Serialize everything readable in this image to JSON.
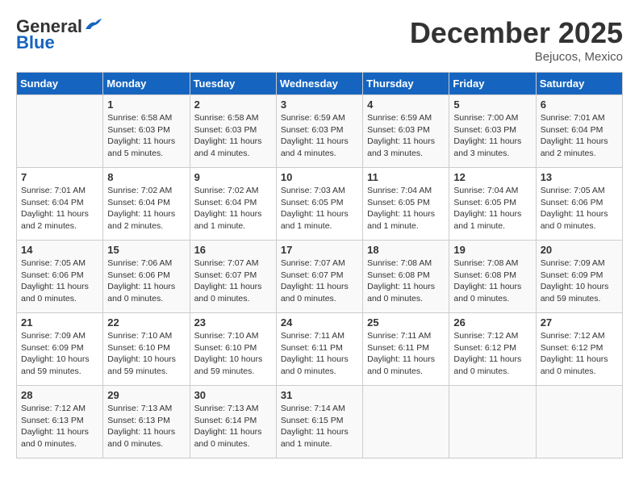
{
  "header": {
    "logo_general": "General",
    "logo_blue": "Blue",
    "month": "December 2025",
    "location": "Bejucos, Mexico"
  },
  "days_of_week": [
    "Sunday",
    "Monday",
    "Tuesday",
    "Wednesday",
    "Thursday",
    "Friday",
    "Saturday"
  ],
  "weeks": [
    [
      {
        "day": "",
        "info": ""
      },
      {
        "day": "1",
        "info": "Sunrise: 6:58 AM\nSunset: 6:03 PM\nDaylight: 11 hours\nand 5 minutes."
      },
      {
        "day": "2",
        "info": "Sunrise: 6:58 AM\nSunset: 6:03 PM\nDaylight: 11 hours\nand 4 minutes."
      },
      {
        "day": "3",
        "info": "Sunrise: 6:59 AM\nSunset: 6:03 PM\nDaylight: 11 hours\nand 4 minutes."
      },
      {
        "day": "4",
        "info": "Sunrise: 6:59 AM\nSunset: 6:03 PM\nDaylight: 11 hours\nand 3 minutes."
      },
      {
        "day": "5",
        "info": "Sunrise: 7:00 AM\nSunset: 6:03 PM\nDaylight: 11 hours\nand 3 minutes."
      },
      {
        "day": "6",
        "info": "Sunrise: 7:01 AM\nSunset: 6:04 PM\nDaylight: 11 hours\nand 2 minutes."
      }
    ],
    [
      {
        "day": "7",
        "info": "Sunrise: 7:01 AM\nSunset: 6:04 PM\nDaylight: 11 hours\nand 2 minutes."
      },
      {
        "day": "8",
        "info": "Sunrise: 7:02 AM\nSunset: 6:04 PM\nDaylight: 11 hours\nand 2 minutes."
      },
      {
        "day": "9",
        "info": "Sunrise: 7:02 AM\nSunset: 6:04 PM\nDaylight: 11 hours\nand 1 minute."
      },
      {
        "day": "10",
        "info": "Sunrise: 7:03 AM\nSunset: 6:05 PM\nDaylight: 11 hours\nand 1 minute."
      },
      {
        "day": "11",
        "info": "Sunrise: 7:04 AM\nSunset: 6:05 PM\nDaylight: 11 hours\nand 1 minute."
      },
      {
        "day": "12",
        "info": "Sunrise: 7:04 AM\nSunset: 6:05 PM\nDaylight: 11 hours\nand 1 minute."
      },
      {
        "day": "13",
        "info": "Sunrise: 7:05 AM\nSunset: 6:06 PM\nDaylight: 11 hours\nand 0 minutes."
      }
    ],
    [
      {
        "day": "14",
        "info": "Sunrise: 7:05 AM\nSunset: 6:06 PM\nDaylight: 11 hours\nand 0 minutes."
      },
      {
        "day": "15",
        "info": "Sunrise: 7:06 AM\nSunset: 6:06 PM\nDaylight: 11 hours\nand 0 minutes."
      },
      {
        "day": "16",
        "info": "Sunrise: 7:07 AM\nSunset: 6:07 PM\nDaylight: 11 hours\nand 0 minutes."
      },
      {
        "day": "17",
        "info": "Sunrise: 7:07 AM\nSunset: 6:07 PM\nDaylight: 11 hours\nand 0 minutes."
      },
      {
        "day": "18",
        "info": "Sunrise: 7:08 AM\nSunset: 6:08 PM\nDaylight: 11 hours\nand 0 minutes."
      },
      {
        "day": "19",
        "info": "Sunrise: 7:08 AM\nSunset: 6:08 PM\nDaylight: 11 hours\nand 0 minutes."
      },
      {
        "day": "20",
        "info": "Sunrise: 7:09 AM\nSunset: 6:09 PM\nDaylight: 10 hours\nand 59 minutes."
      }
    ],
    [
      {
        "day": "21",
        "info": "Sunrise: 7:09 AM\nSunset: 6:09 PM\nDaylight: 10 hours\nand 59 minutes."
      },
      {
        "day": "22",
        "info": "Sunrise: 7:10 AM\nSunset: 6:10 PM\nDaylight: 10 hours\nand 59 minutes."
      },
      {
        "day": "23",
        "info": "Sunrise: 7:10 AM\nSunset: 6:10 PM\nDaylight: 10 hours\nand 59 minutes."
      },
      {
        "day": "24",
        "info": "Sunrise: 7:11 AM\nSunset: 6:11 PM\nDaylight: 11 hours\nand 0 minutes."
      },
      {
        "day": "25",
        "info": "Sunrise: 7:11 AM\nSunset: 6:11 PM\nDaylight: 11 hours\nand 0 minutes."
      },
      {
        "day": "26",
        "info": "Sunrise: 7:12 AM\nSunset: 6:12 PM\nDaylight: 11 hours\nand 0 minutes."
      },
      {
        "day": "27",
        "info": "Sunrise: 7:12 AM\nSunset: 6:12 PM\nDaylight: 11 hours\nand 0 minutes."
      }
    ],
    [
      {
        "day": "28",
        "info": "Sunrise: 7:12 AM\nSunset: 6:13 PM\nDaylight: 11 hours\nand 0 minutes."
      },
      {
        "day": "29",
        "info": "Sunrise: 7:13 AM\nSunset: 6:13 PM\nDaylight: 11 hours\nand 0 minutes."
      },
      {
        "day": "30",
        "info": "Sunrise: 7:13 AM\nSunset: 6:14 PM\nDaylight: 11 hours\nand 0 minutes."
      },
      {
        "day": "31",
        "info": "Sunrise: 7:14 AM\nSunset: 6:15 PM\nDaylight: 11 hours\nand 1 minute."
      },
      {
        "day": "",
        "info": ""
      },
      {
        "day": "",
        "info": ""
      },
      {
        "day": "",
        "info": ""
      }
    ]
  ]
}
